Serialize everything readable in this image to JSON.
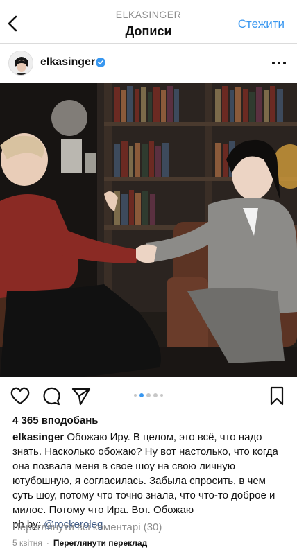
{
  "nav": {
    "account": "ELKASINGER",
    "title": "Дописи",
    "follow_label": "Стежити"
  },
  "post": {
    "username": "elkasinger",
    "likes": "4 365 вподобань",
    "caption_user": "elkasinger",
    "caption_text": "Обожаю Иру. В целом, это всё, что надо знать. Насколько обожаю? Ну вот настолько, что когда она позвала меня в свое шоу на свою личную ютубошную, я согласилась. Забыла спросить, в чем суть шоу, потому что точно знала, что что-то доброе и милое. Потому что Ира. Вот. Обожаю",
    "photo_credit_prefix": "ph by:",
    "photo_credit_mention": "@rockeroleg",
    "view_comments": "Переглянути всі коментарі (30)",
    "date": "5 квітня",
    "translate": "Переглянути переклад"
  },
  "icons": {
    "back": "chevron-left-icon",
    "verified": "verified-badge-icon",
    "more": "more-horizontal-icon",
    "like": "heart-icon",
    "comment": "comment-icon",
    "share": "send-icon",
    "save": "bookmark-icon"
  },
  "carousel": {
    "count": 5,
    "active_index": 1
  },
  "colors": {
    "accent": "#3897f0",
    "mention": "#3f5a85",
    "muted": "#8e8e8e"
  }
}
